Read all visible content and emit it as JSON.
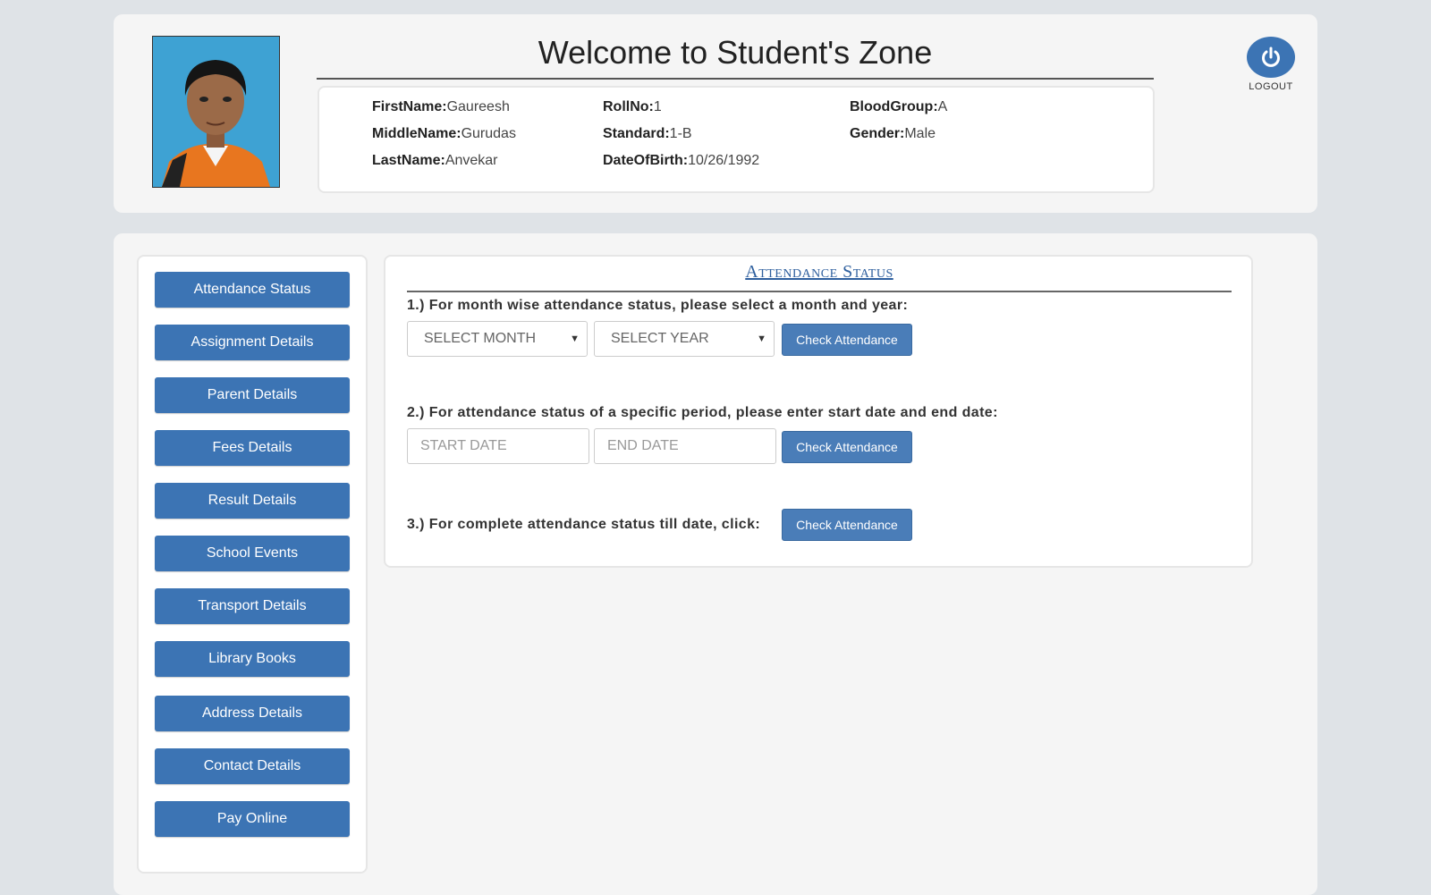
{
  "header": {
    "welcome_title": "Welcome to Student's Zone",
    "logout_label": "LOGOUT"
  },
  "student": {
    "first_name_label": "FirstName:",
    "first_name": "Gaureesh",
    "middle_name_label": "MiddleName:",
    "middle_name": "Gurudas",
    "last_name_label": "LastName:",
    "last_name": "Anvekar",
    "roll_no_label": "RollNo:",
    "roll_no": "1",
    "standard_label": "Standard:",
    "standard": "1-B",
    "dob_label": "DateOfBirth:",
    "dob": "10/26/1992",
    "blood_group_label": "BloodGroup:",
    "blood_group": "A",
    "gender_label": "Gender:",
    "gender": "Male"
  },
  "sidebar": {
    "items": [
      {
        "label": "Attendance Status"
      },
      {
        "label": "Assignment Details"
      },
      {
        "label": "Parent Details"
      },
      {
        "label": "Fees Details"
      },
      {
        "label": "Result Details"
      },
      {
        "label": "School Events"
      },
      {
        "label": "Transport Details"
      },
      {
        "label": "Library Books"
      },
      {
        "label": "Address Details"
      },
      {
        "label": "Contact Details"
      },
      {
        "label": "Pay Online"
      }
    ]
  },
  "attendance": {
    "section_title": "Attendance Status",
    "step1_text": "1.) For month wise attendance status, please select a month and year:",
    "month_select": "SELECT MONTH",
    "year_select": "SELECT YEAR",
    "step2_text": "2.) For attendance status of a specific period, please enter start date and end date:",
    "start_date_placeholder": "START DATE",
    "end_date_placeholder": "END DATE",
    "step3_text": "3.) For complete attendance status till date, click:",
    "check_button_label": "Check Attendance"
  },
  "colors": {
    "button_blue": "#3c74b4",
    "title_blue": "#2e5f9e",
    "page_bg": "#dfe3e7",
    "panel_bg": "#f5f5f5"
  },
  "icons": {
    "logout": "power-icon",
    "photo": "student-photo"
  }
}
